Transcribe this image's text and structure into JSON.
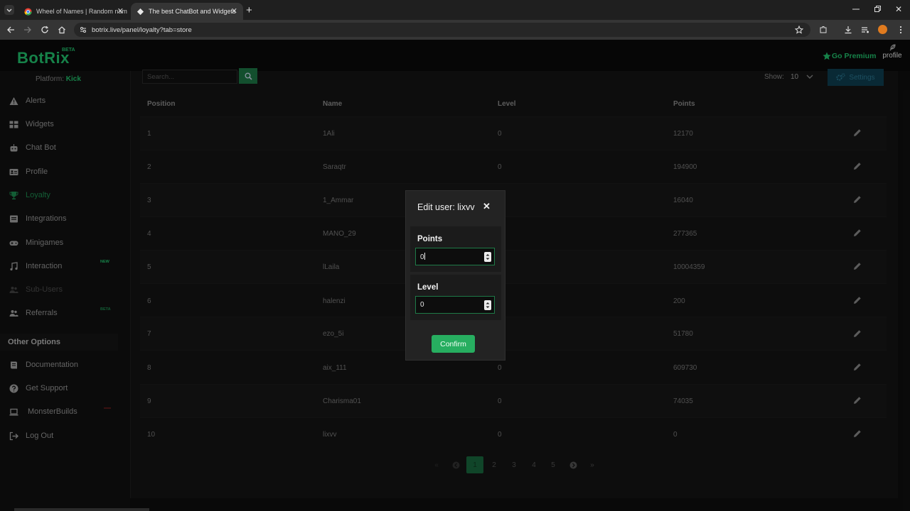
{
  "browser": {
    "tabs": [
      {
        "title": "Wheel of Names | Random nam",
        "active": false
      },
      {
        "title": "The best ChatBot and Widgets",
        "active": true
      }
    ],
    "url": "botrix.live/panel/loyalty?tab=store"
  },
  "app": {
    "logo": "BotRix",
    "logo_badge": "BETA",
    "go_premium": "Go Premium",
    "profile": "profile",
    "accent": "#23c870"
  },
  "sidebar": {
    "platform_label": "Platform:",
    "platform_value": "Kick",
    "items": [
      {
        "label": "Alerts",
        "icon": "warning-icon"
      },
      {
        "label": "Widgets",
        "icon": "widgets-icon"
      },
      {
        "label": "Chat Bot",
        "icon": "robot-icon"
      },
      {
        "label": "Profile",
        "icon": "profile-card-icon"
      },
      {
        "label": "Loyalty",
        "icon": "trophy-icon"
      },
      {
        "label": "Integrations",
        "icon": "integrations-icon"
      },
      {
        "label": "Minigames",
        "icon": "gamepad-icon"
      },
      {
        "label": "Interaction",
        "icon": "music-icon",
        "tag": "NEW"
      },
      {
        "label": "Sub-Users",
        "icon": "users-icon"
      },
      {
        "label": "Referrals",
        "icon": "referrals-icon",
        "tag": "BETA"
      }
    ],
    "other_heading": "Other Options",
    "other_items": [
      {
        "label": "Documentation",
        "icon": "docs-icon"
      },
      {
        "label": "Get Support",
        "icon": "help-icon"
      },
      {
        "label": "MonsterBuilds",
        "icon": "laptop-icon"
      },
      {
        "label": "Log Out",
        "icon": "logout-icon"
      }
    ]
  },
  "toolbar": {
    "search_placeholder": "Search...",
    "show_label": "Show:",
    "show_value": "10",
    "settings_label": "Settings"
  },
  "table": {
    "headers": [
      "Position",
      "Name",
      "Level",
      "Points"
    ],
    "rows": [
      {
        "position": "1",
        "name": "1Ali",
        "level": "0",
        "points": "12170"
      },
      {
        "position": "2",
        "name": "Saraqtr",
        "level": "0",
        "points": "194900"
      },
      {
        "position": "3",
        "name": "1_Ammar",
        "level": "",
        "points": "16040"
      },
      {
        "position": "4",
        "name": "MANO_29",
        "level": "",
        "points": "277365"
      },
      {
        "position": "5",
        "name": "lLaila",
        "level": "",
        "points": "10004359"
      },
      {
        "position": "6",
        "name": "halenzi",
        "level": "",
        "points": "200"
      },
      {
        "position": "7",
        "name": "ezo_5i",
        "level": "",
        "points": "51780"
      },
      {
        "position": "8",
        "name": "aix_111",
        "level": "0",
        "points": "609730"
      },
      {
        "position": "9",
        "name": "Charisma01",
        "level": "0",
        "points": "74035"
      },
      {
        "position": "10",
        "name": "lixvv",
        "level": "0",
        "points": "0"
      }
    ]
  },
  "pagination": {
    "first": "«",
    "prev": "‹",
    "pages": [
      "1",
      "2",
      "3",
      "4",
      "5"
    ],
    "current": "1",
    "next": "›",
    "last": "»"
  },
  "modal": {
    "title": "Edit user: lixvv",
    "points_label": "Points",
    "points_value": "0",
    "level_label": "Level",
    "level_value": "0",
    "confirm_label": "Confirm"
  }
}
